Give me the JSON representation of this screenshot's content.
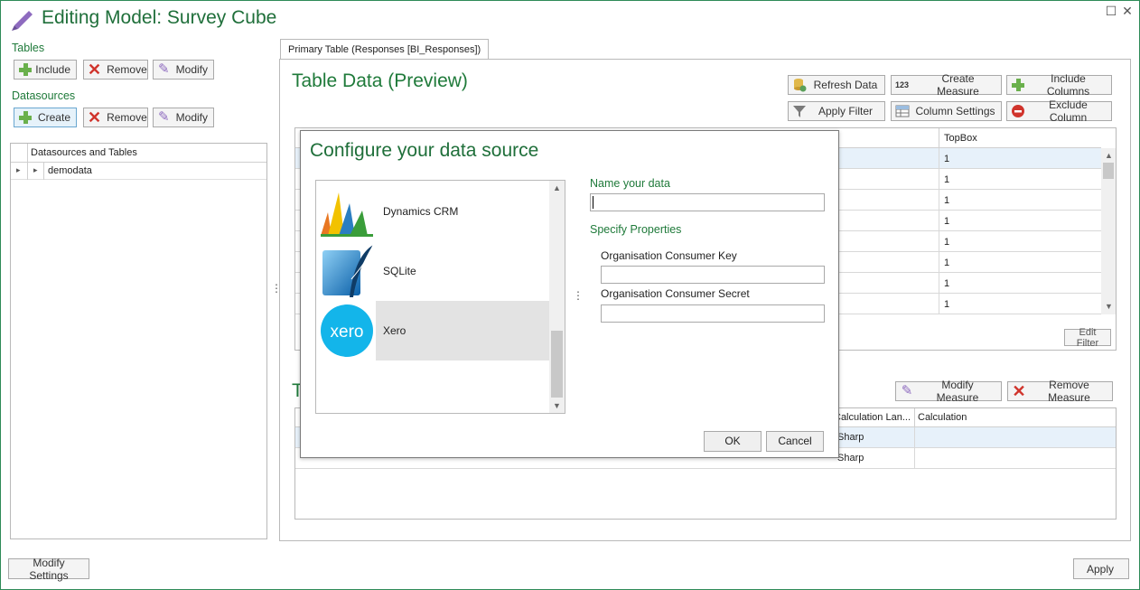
{
  "window": {
    "title": "Editing Model: Survey Cube",
    "maximize_glyph": "☐",
    "close_glyph": "✕"
  },
  "left_panel": {
    "tables_label": "Tables",
    "tables_buttons": {
      "include": "Include",
      "remove": "Remove",
      "modify": "Modify"
    },
    "datasources_label": "Datasources",
    "datasources_buttons": {
      "create": "Create",
      "remove": "Remove",
      "modify": "Modify"
    },
    "tree_header": "Datasources and Tables",
    "tree_items": [
      {
        "label": "demodata"
      }
    ]
  },
  "main": {
    "tab_label": "Primary Table (Responses [BI_Responses])",
    "table_data_title": "Table Data (Preview)",
    "toolbar": {
      "refresh_data": "Refresh Data",
      "create_measure": "Create Measure",
      "create_measure_badge": "123",
      "include_columns": "Include Columns",
      "apply_filter": "Apply Filter",
      "column_settings": "Column Settings",
      "exclude_column": "Exclude Column"
    },
    "preview_grid": {
      "visible_header": "TopBox",
      "values": [
        "1",
        "1",
        "1",
        "1",
        "1",
        "1",
        "1",
        "1"
      ]
    },
    "edit_filter": "Edit Filter",
    "measures_title_partial": "T",
    "measure_toolbar": {
      "modify_measure": "Modify Measure",
      "remove_measure": "Remove Measure"
    },
    "measures_grid": {
      "headers": {
        "calc_lang": "Calculation Lan...",
        "calculation": "Calculation"
      },
      "rows": [
        {
          "calc_lang": "Sharp",
          "calculation": ""
        },
        {
          "calc_lang": "Sharp",
          "calculation": ""
        }
      ]
    }
  },
  "dialog": {
    "title": "Configure your data source",
    "datasources": [
      {
        "name": "Dynamics CRM",
        "icon": "dynamics-crm-icon"
      },
      {
        "name": "SQLite",
        "icon": "sqlite-icon"
      },
      {
        "name": "Xero",
        "icon": "xero-icon",
        "selected": true
      }
    ],
    "name_label": "Name your data",
    "name_value": "",
    "properties_label": "Specify Properties",
    "properties": [
      {
        "label": "Organisation Consumer Key",
        "value": ""
      },
      {
        "label": "Organisation Consumer Secret",
        "value": ""
      }
    ],
    "ok": "OK",
    "cancel": "Cancel",
    "splitter_glyph": "⋮"
  },
  "footer": {
    "modify_settings": "Modify Settings",
    "apply": "Apply"
  },
  "colors": {
    "accent_green": "#1f7a3a",
    "xero_blue": "#13b5ea",
    "selection": "#e3e3e3"
  }
}
